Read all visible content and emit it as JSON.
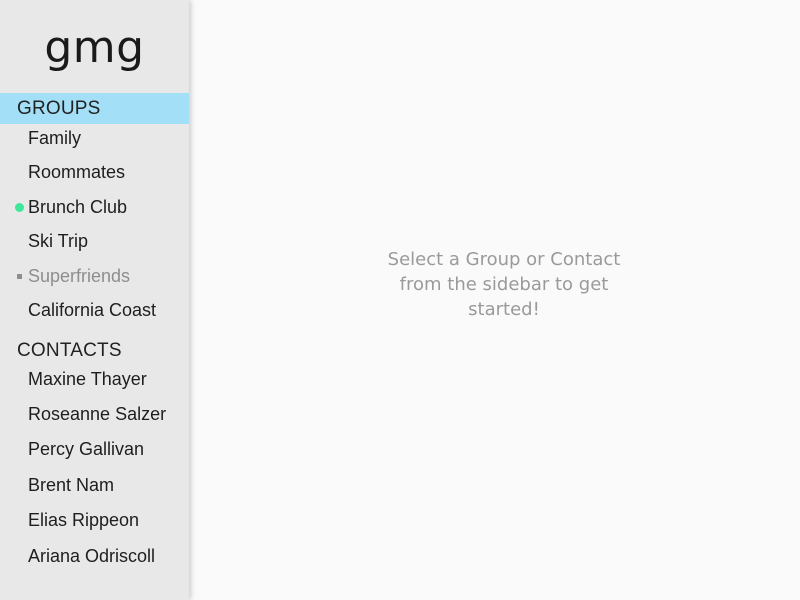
{
  "app": {
    "logo": "gmg"
  },
  "sidebar": {
    "groups_header": "GROUPS",
    "contacts_header": "CONTACTS",
    "groups": [
      {
        "label": "Family",
        "indicator": "none"
      },
      {
        "label": "Roommates",
        "indicator": "none"
      },
      {
        "label": "Brunch Club",
        "indicator": "green-dot"
      },
      {
        "label": "Ski Trip",
        "indicator": "none"
      },
      {
        "label": "Superfriends",
        "indicator": "gray-square"
      },
      {
        "label": "California Coast",
        "indicator": "none"
      }
    ],
    "contacts": [
      {
        "label": "Maxine Thayer"
      },
      {
        "label": "Roseanne Salzer"
      },
      {
        "label": "Percy Gallivan"
      },
      {
        "label": "Brent Nam"
      },
      {
        "label": "Elias Rippeon"
      },
      {
        "label": "Ariana Odriscoll"
      }
    ]
  },
  "main": {
    "placeholder": "Select a Group or Contact from the sidebar to get started!"
  },
  "colors": {
    "sidebar_bg": "#e8e8e8",
    "active_header_bg": "#a4dff8",
    "online_dot": "#3de89a",
    "placeholder_text": "#9a9a9a",
    "main_bg": "#fafafa"
  }
}
